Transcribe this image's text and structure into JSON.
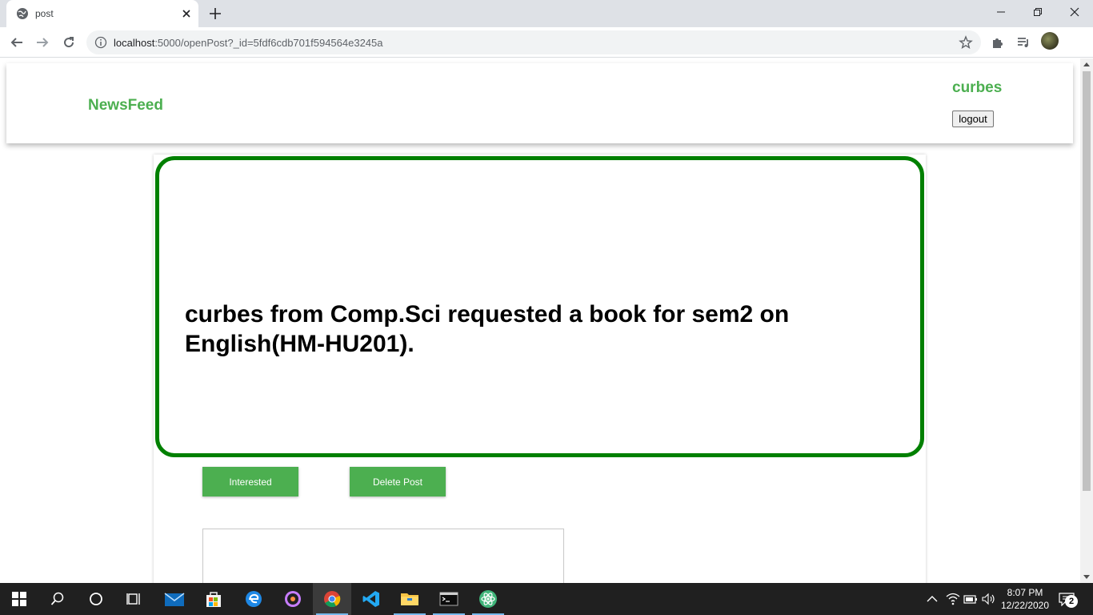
{
  "browser": {
    "tab_title": "post",
    "url_host": "localhost",
    "url_rest": ":5000/openPost?_id=5fdf6cdb701f594564e3245a"
  },
  "header": {
    "brand": "NewsFeed",
    "username": "curbes",
    "logout_label": "logout"
  },
  "post": {
    "text": "curbes from Comp.Sci requested a book for sem2 on English(HM-HU201)."
  },
  "actions": {
    "interested_label": "Interested",
    "delete_label": "Delete Post"
  },
  "taskbar": {
    "time": "8:07 PM",
    "date": "12/22/2020",
    "notifications": "2"
  },
  "colors": {
    "accent": "#4caf50",
    "post_border": "#008000"
  }
}
